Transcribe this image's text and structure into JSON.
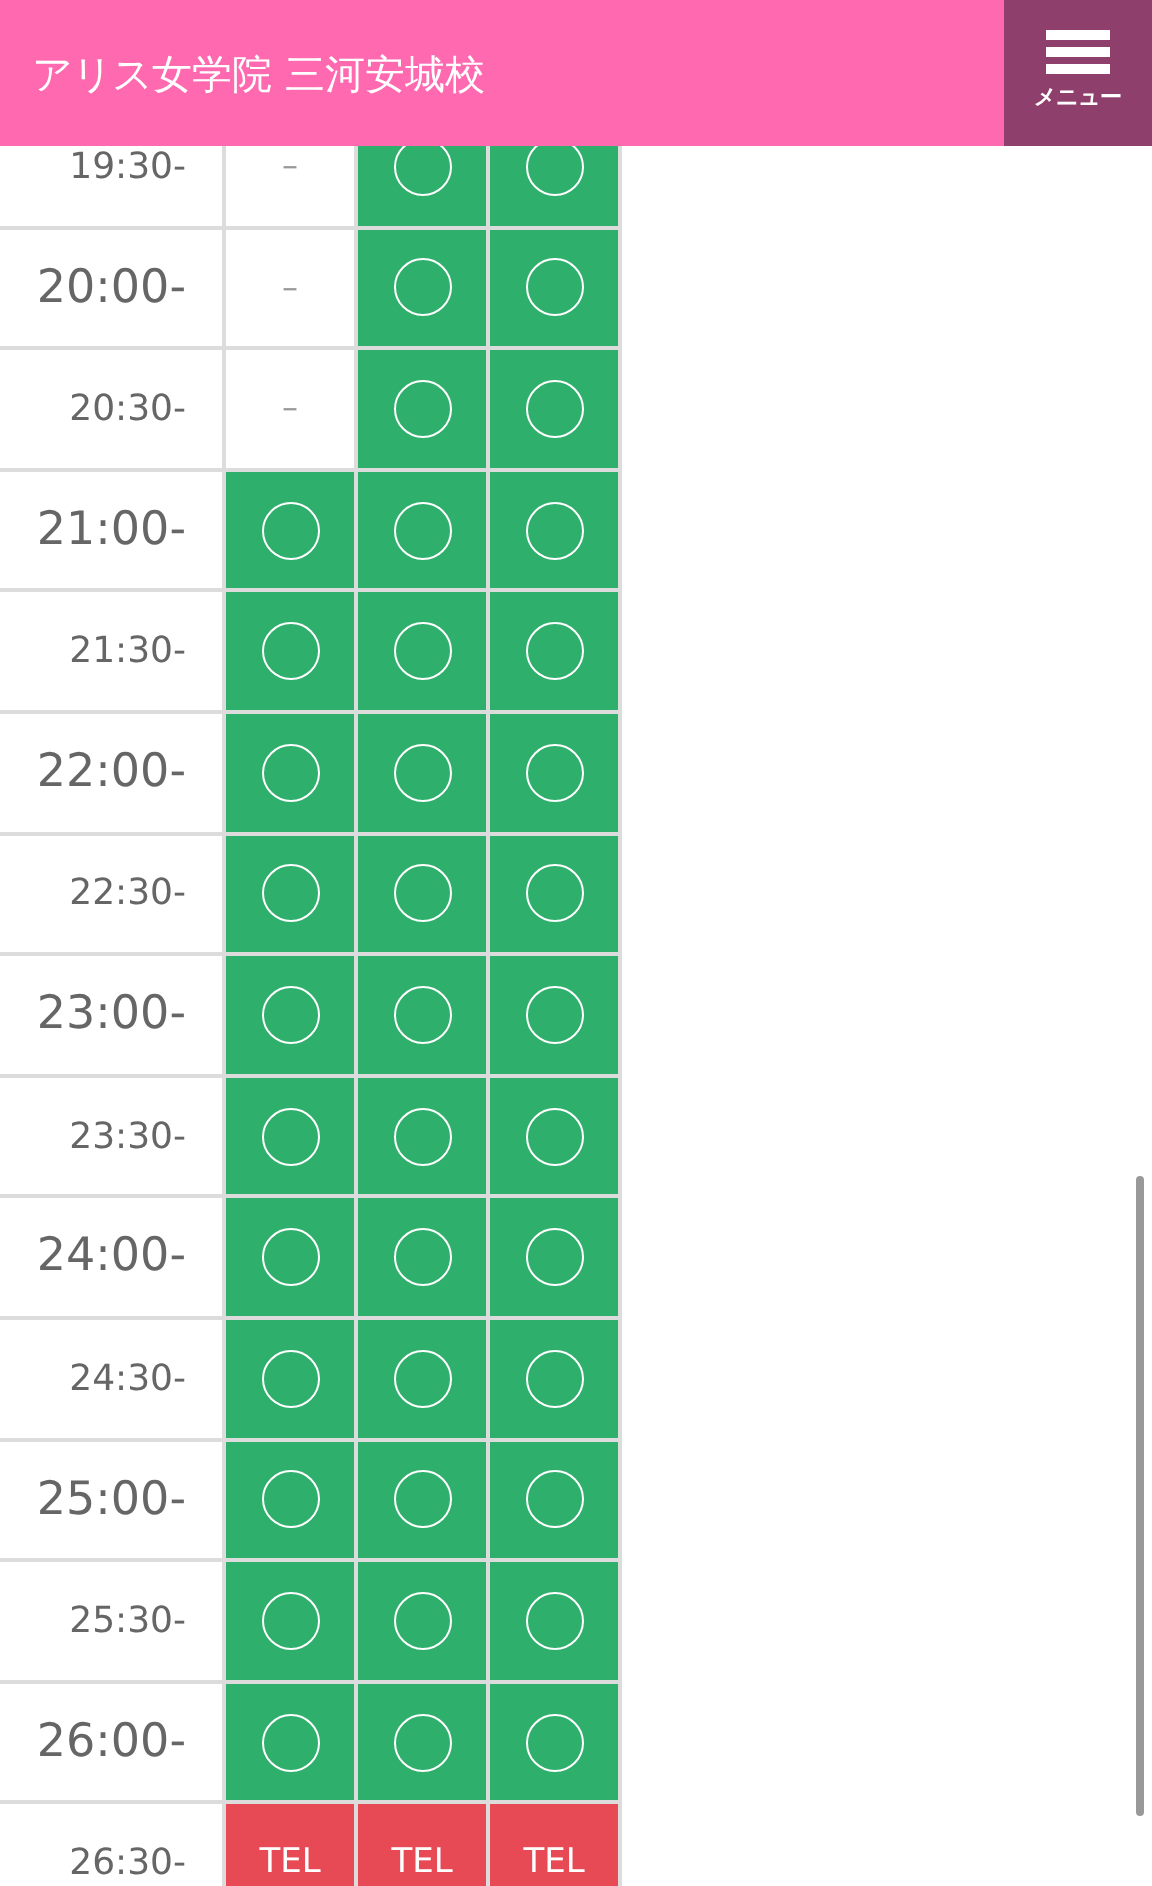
{
  "header": {
    "title": "アリス女学院 三河安城校",
    "menu_label": "メニュー"
  },
  "rows": [
    {
      "time": "19:30-",
      "on_the_hour": false,
      "cells": [
        {
          "kind": "dash",
          "text": "–"
        },
        {
          "kind": "available"
        },
        {
          "kind": "available"
        }
      ]
    },
    {
      "time": "20:00-",
      "on_the_hour": true,
      "cells": [
        {
          "kind": "dash",
          "text": "–"
        },
        {
          "kind": "available"
        },
        {
          "kind": "available"
        }
      ]
    },
    {
      "time": "20:30-",
      "on_the_hour": false,
      "cells": [
        {
          "kind": "dash",
          "text": "–"
        },
        {
          "kind": "available"
        },
        {
          "kind": "available"
        }
      ]
    },
    {
      "time": "21:00-",
      "on_the_hour": true,
      "cells": [
        {
          "kind": "available"
        },
        {
          "kind": "available"
        },
        {
          "kind": "available"
        }
      ]
    },
    {
      "time": "21:30-",
      "on_the_hour": false,
      "cells": [
        {
          "kind": "available"
        },
        {
          "kind": "available"
        },
        {
          "kind": "available"
        }
      ]
    },
    {
      "time": "22:00-",
      "on_the_hour": true,
      "cells": [
        {
          "kind": "available"
        },
        {
          "kind": "available"
        },
        {
          "kind": "available"
        }
      ]
    },
    {
      "time": "22:30-",
      "on_the_hour": false,
      "cells": [
        {
          "kind": "available"
        },
        {
          "kind": "available"
        },
        {
          "kind": "available"
        }
      ]
    },
    {
      "time": "23:00-",
      "on_the_hour": true,
      "cells": [
        {
          "kind": "available"
        },
        {
          "kind": "available"
        },
        {
          "kind": "available"
        }
      ]
    },
    {
      "time": "23:30-",
      "on_the_hour": false,
      "cells": [
        {
          "kind": "available"
        },
        {
          "kind": "available"
        },
        {
          "kind": "available"
        }
      ]
    },
    {
      "time": "24:00-",
      "on_the_hour": true,
      "cells": [
        {
          "kind": "available"
        },
        {
          "kind": "available"
        },
        {
          "kind": "available"
        }
      ]
    },
    {
      "time": "24:30-",
      "on_the_hour": false,
      "cells": [
        {
          "kind": "available"
        },
        {
          "kind": "available"
        },
        {
          "kind": "available"
        }
      ]
    },
    {
      "time": "25:00-",
      "on_the_hour": true,
      "cells": [
        {
          "kind": "available"
        },
        {
          "kind": "available"
        },
        {
          "kind": "available"
        }
      ]
    },
    {
      "time": "25:30-",
      "on_the_hour": false,
      "cells": [
        {
          "kind": "available"
        },
        {
          "kind": "available"
        },
        {
          "kind": "available"
        }
      ]
    },
    {
      "time": "26:00-",
      "on_the_hour": true,
      "cells": [
        {
          "kind": "available"
        },
        {
          "kind": "available"
        },
        {
          "kind": "available"
        }
      ]
    },
    {
      "time": "26:30-",
      "on_the_hour": false,
      "cells": [
        {
          "kind": "tel",
          "text": "TEL"
        },
        {
          "kind": "tel",
          "text": "TEL"
        },
        {
          "kind": "tel",
          "text": "TEL"
        }
      ]
    }
  ]
}
